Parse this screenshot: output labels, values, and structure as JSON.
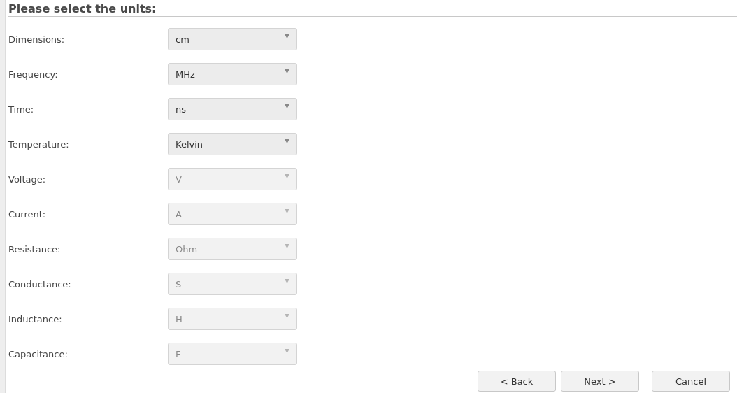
{
  "heading": "Please select the units:",
  "units": [
    {
      "label": "Dimensions:",
      "value": "cm",
      "disabled": false
    },
    {
      "label": "Frequency:",
      "value": "MHz",
      "disabled": false
    },
    {
      "label": "Time:",
      "value": "ns",
      "disabled": false
    },
    {
      "label": "Temperature:",
      "value": "Kelvin",
      "disabled": false
    },
    {
      "label": "Voltage:",
      "value": "V",
      "disabled": true
    },
    {
      "label": "Current:",
      "value": "A",
      "disabled": true
    },
    {
      "label": "Resistance:",
      "value": "Ohm",
      "disabled": true
    },
    {
      "label": "Conductance:",
      "value": "S",
      "disabled": true
    },
    {
      "label": "Inductance:",
      "value": "H",
      "disabled": true
    },
    {
      "label": "Capacitance:",
      "value": "F",
      "disabled": true
    }
  ],
  "buttons": [
    {
      "label": "< Back"
    },
    {
      "label": "Next >"
    },
    {
      "label": "Cancel"
    }
  ]
}
